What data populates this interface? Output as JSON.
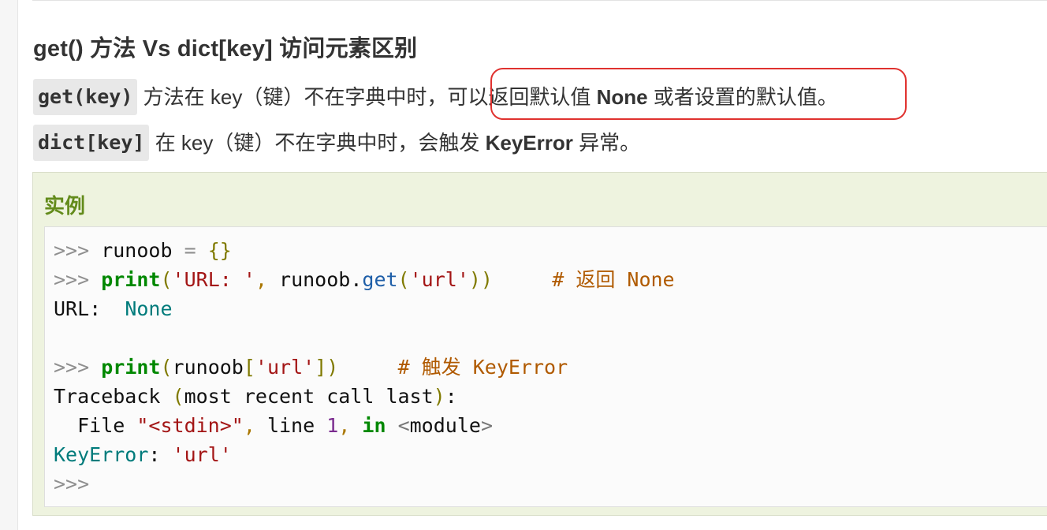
{
  "heading": "get() 方法 Vs dict[key] 访问元素区别",
  "para1": {
    "code": "get(key)",
    "text_a": " 方法在 key（键）不在字典中时，",
    "text_b": "可以返回默认值 ",
    "bold": "None",
    "text_c": " 或者设置的默认值。"
  },
  "para2": {
    "code": "dict[key]",
    "text_a": " 在 key（键）不在字典中时，会触发 ",
    "bold": "KeyError",
    "text_b": " 异常。"
  },
  "highlight_color": "#e0322f",
  "example": {
    "title": "实例",
    "title_color": "#638b1b",
    "lines": {
      "l1": {
        "prompt": ">>>",
        "code": " runoob ",
        "eq": "=",
        "sp": " ",
        "braces": "{}"
      },
      "l2": {
        "prompt": ">>>",
        "sp": " ",
        "kw": "print",
        "po": "(",
        "str1": "'URL: '",
        "comma": ",",
        "mid": " runoob.",
        "method": "get",
        "po2": "(",
        "str2": "'url'",
        "pc": "))",
        "gap": "     ",
        "comment": "# 返回 None"
      },
      "l3": {
        "text": "URL:  ",
        "none": "None"
      },
      "l4": {
        "prompt": ">>>",
        "sp": " ",
        "kw": "print",
        "po": "(",
        "mid": "runoob",
        "bo": "[",
        "str": "'url'",
        "bc": "]",
        "pc": ")",
        "gap": "     ",
        "comment": "# 触发 KeyError"
      },
      "l5": {
        "a": "Traceback ",
        "po": "(",
        "b": "most recent call last",
        "pc": ")",
        "c": ":"
      },
      "l6": {
        "a": "  File ",
        "str": "\"<stdin>\"",
        "comma": ",",
        "b": " line ",
        "num": "1",
        "comma2": ",",
        "sp": " ",
        "kw": "in",
        "sp2": " ",
        "lt": "<",
        "mod": "module",
        "gt": ">"
      },
      "l7": {
        "err": "KeyError",
        "colon": ":",
        "sp": " ",
        "str": "'url'"
      },
      "l8": {
        "prompt": ">>>"
      }
    }
  }
}
